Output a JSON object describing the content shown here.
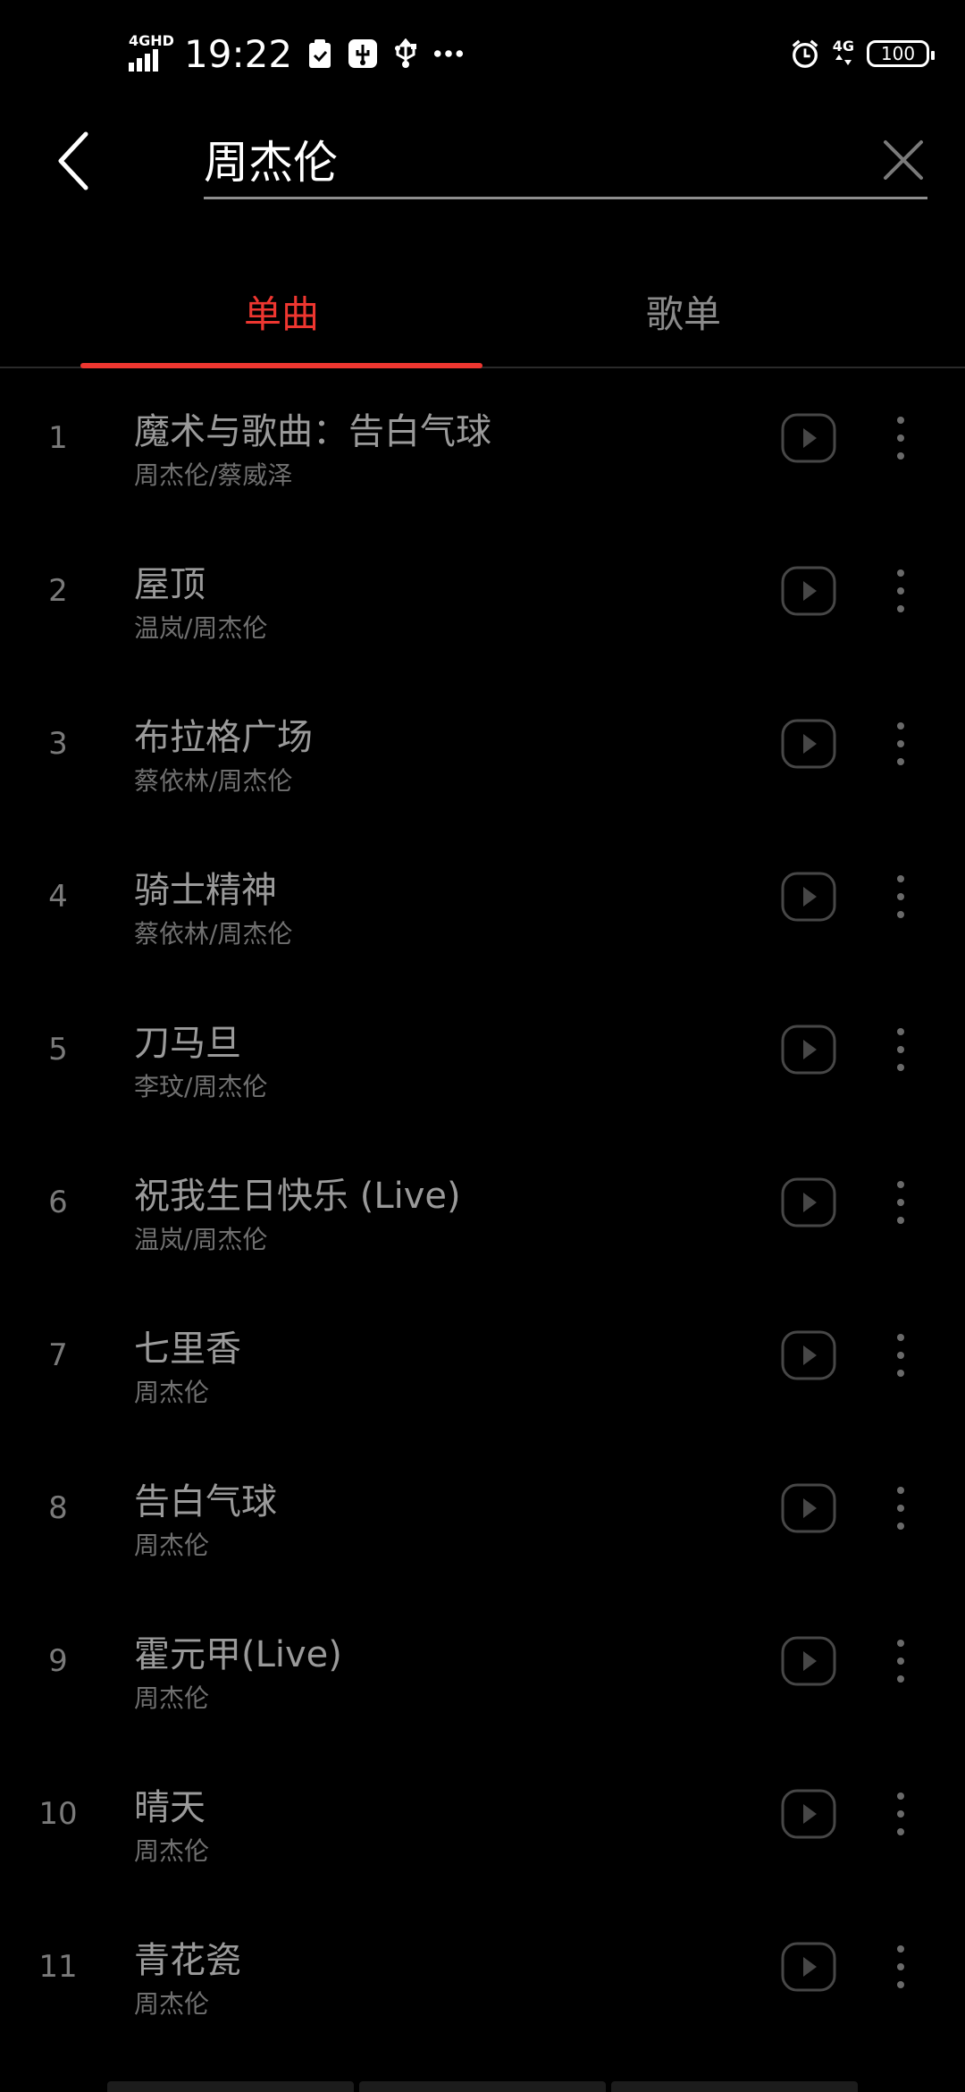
{
  "status_bar": {
    "network_label": "4GHD",
    "time": "19:22",
    "mobile_network": "4G",
    "battery": "100"
  },
  "search": {
    "query": "周杰伦"
  },
  "tabs": [
    {
      "label": "单曲",
      "active": true
    },
    {
      "label": "歌单",
      "active": false
    }
  ],
  "songs": [
    {
      "index": "1",
      "title": "魔术与歌曲：告白气球",
      "artist": "周杰伦/蔡威泽"
    },
    {
      "index": "2",
      "title": "屋顶",
      "artist": "温岚/周杰伦"
    },
    {
      "index": "3",
      "title": "布拉格广场",
      "artist": "蔡依林/周杰伦"
    },
    {
      "index": "4",
      "title": "骑士精神",
      "artist": "蔡依林/周杰伦"
    },
    {
      "index": "5",
      "title": "刀马旦",
      "artist": "李玟/周杰伦"
    },
    {
      "index": "6",
      "title": "祝我生日快乐 (Live)",
      "artist": "温岚/周杰伦"
    },
    {
      "index": "7",
      "title": "七里香",
      "artist": "周杰伦"
    },
    {
      "index": "8",
      "title": "告白气球",
      "artist": "周杰伦"
    },
    {
      "index": "9",
      "title": "霍元甲(Live)",
      "artist": "周杰伦"
    },
    {
      "index": "10",
      "title": "晴天",
      "artist": "周杰伦"
    },
    {
      "index": "11",
      "title": "青花瓷",
      "artist": "周杰伦"
    }
  ],
  "icons": {
    "back": "back-arrow-icon",
    "clear": "close-icon",
    "play": "play-icon",
    "more": "more-vertical-icon"
  },
  "colors": {
    "background": "#000000",
    "accent": "#ee3630",
    "title_text": "#9a9a9a",
    "artist_text": "#707070"
  }
}
